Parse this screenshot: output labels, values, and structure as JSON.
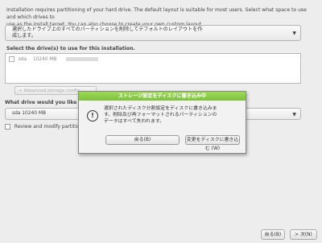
{
  "intro": {
    "line1": "Installation requires partitioning of your hard drive. The default layout is suitable for most users. Select what space to use and which drives to",
    "line2": "use as the install target. You can also choose to create your own custom layout."
  },
  "layout_combo": {
    "line1": "選択したドライブ上のすべてのパーティションを削除してデフォルトのレイアウトを作",
    "line2": "成します。"
  },
  "drives_label": "Select the drive(s) to use for this installation.",
  "drive": {
    "name": "sda",
    "size": "10240 MB"
  },
  "advanced_button": "+ Advanced storage config",
  "boot_label": "What drive would you like to bo",
  "boot_combo": {
    "value": "sda    10240 MB"
  },
  "review_label": "Review and modify partitioni",
  "footer": {
    "back": "戻る(B)",
    "next": "> 次(N)"
  },
  "dialog": {
    "title": "ストレージ設定をディスクに書き込み中",
    "icon": "warning-icon",
    "message_line1": "選択されたディスク分割設定をディスクに書き込みま",
    "message_line2": "す。削除及び再フォーマットされるパーティションの",
    "message_line3": "データはすべて失われます。",
    "cancel": "戻る(B)",
    "apply": "変更をディスクに書き込む (W)"
  },
  "colors": {
    "dialog_title_bg": "#86c940",
    "window_bg": "#ededed"
  }
}
